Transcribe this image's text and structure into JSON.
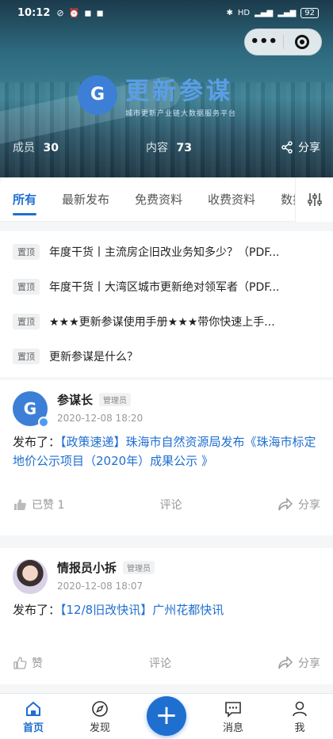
{
  "status_bar": {
    "time": "10:12",
    "battery": "92"
  },
  "capsule": {
    "more": "•••"
  },
  "brand": {
    "logo_letter": "G",
    "title": "更新参谋",
    "subtitle": "城市更新产业链大数据服务平台"
  },
  "stats": {
    "members_label": "成员",
    "members_value": "30",
    "content_label": "内容",
    "content_value": "73",
    "share_label": "分享"
  },
  "tabs": [
    {
      "label": "所有"
    },
    {
      "label": "最新发布"
    },
    {
      "label": "免费资料"
    },
    {
      "label": "收费资料"
    },
    {
      "label": "数据"
    }
  ],
  "pinned": [
    {
      "tag": "置顶",
      "title": "年度干货丨主流房企旧改业务知多少？（PDF..."
    },
    {
      "tag": "置顶",
      "title": "年度干货丨大湾区城市更新绝对领军者（PDF..."
    },
    {
      "tag": "置顶",
      "title": "★★★更新参谋使用手册★★★带你快速上手..."
    },
    {
      "tag": "置顶",
      "title": "更新参谋是什么？"
    }
  ],
  "posts": [
    {
      "author": "参谋长",
      "role": "管理员",
      "time": "2020-12-08 18:20",
      "prefix": "发布了：",
      "link": "【政策速递】珠海市自然资源局发布《珠海市标定地价公示项目（2020年）成果公示 》",
      "like_label": "已赞 1",
      "comment_label": "评论",
      "share_label": "分享"
    },
    {
      "author": "情报员小拆",
      "role": "管理员",
      "time": "2020-12-08 18:07",
      "prefix": "发布了：",
      "link": "【12/8旧改快讯】广州花都快讯",
      "like_label": "赞",
      "comment_label": "评论",
      "share_label": "分享"
    }
  ],
  "bottom_nav": {
    "home": "首页",
    "discover": "发现",
    "add": "+",
    "messages": "消息",
    "me": "我"
  },
  "colors": {
    "accent": "#1f6fd0",
    "logo": "#3d7fd6"
  }
}
